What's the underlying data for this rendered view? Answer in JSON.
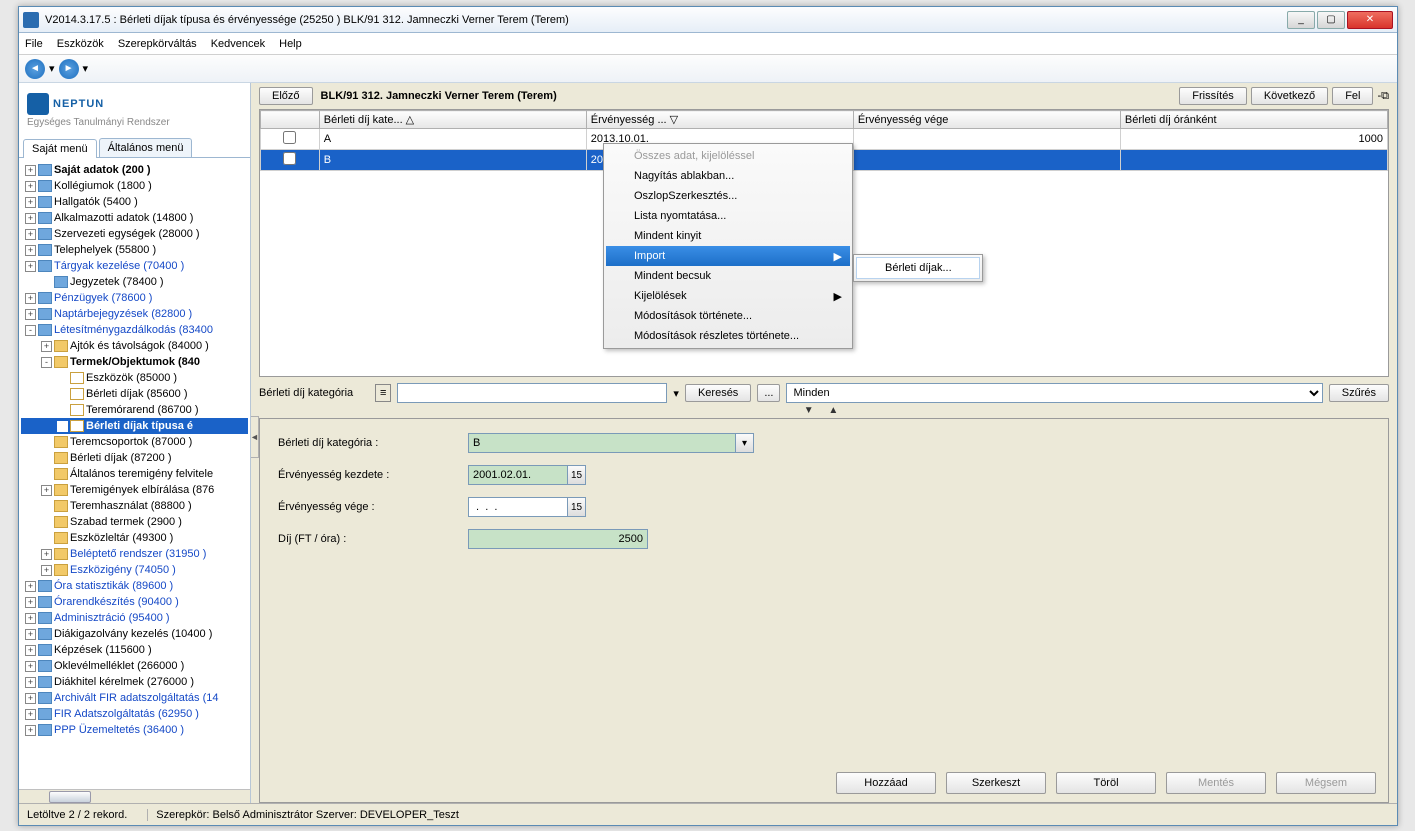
{
  "window": {
    "title": "V2014.3.17.5 : Bérleti díjak típusa és érvényessége (25250  ) BLK/91 312. Jamneczki Verner Terem (Terem)"
  },
  "menubar": [
    "File",
    "Eszközök",
    "Szerepkörváltás",
    "Kedvencek",
    "Help"
  ],
  "logo": {
    "text": "NEPTUN",
    "sub": "Egységes Tanulmányi Rendszer"
  },
  "side_tabs": {
    "a": "Saját menü",
    "b": "Általános menü"
  },
  "tree": [
    {
      "ind": 0,
      "t": "+",
      "ic": "blue",
      "lbl": "Saját adatok (200  )",
      "cls": "bold"
    },
    {
      "ind": 0,
      "t": "+",
      "ic": "blue",
      "lbl": "Kollégiumok (1800  )"
    },
    {
      "ind": 0,
      "t": "+",
      "ic": "blue",
      "lbl": "Hallgatók (5400  )"
    },
    {
      "ind": 0,
      "t": "+",
      "ic": "blue",
      "lbl": "Alkalmazotti adatok (14800  )"
    },
    {
      "ind": 0,
      "t": "+",
      "ic": "blue",
      "lbl": "Szervezeti egységek (28000  )"
    },
    {
      "ind": 0,
      "t": "+",
      "ic": "blue",
      "lbl": "Telephelyek (55800  )"
    },
    {
      "ind": 0,
      "t": "+",
      "ic": "blue",
      "lbl": "Tárgyak kezelése (70400  )",
      "cls": "link"
    },
    {
      "ind": 1,
      "t": " ",
      "ic": "blue",
      "lbl": "Jegyzetek (78400  )"
    },
    {
      "ind": 0,
      "t": "+",
      "ic": "blue",
      "lbl": "Pénzügyek (78600  )",
      "cls": "link"
    },
    {
      "ind": 0,
      "t": "+",
      "ic": "blue",
      "lbl": "Naptárbejegyzések (82800  )",
      "cls": "link"
    },
    {
      "ind": 0,
      "t": "-",
      "ic": "blue",
      "lbl": "Létesítménygazdálkodás (83400",
      "cls": "link"
    },
    {
      "ind": 1,
      "t": "+",
      "ic": "y",
      "lbl": "Ajtók és távolságok (84000  )"
    },
    {
      "ind": 1,
      "t": "-",
      "ic": "y",
      "lbl": "Termek/Objektumok (840",
      "cls": "bold"
    },
    {
      "ind": 2,
      "t": " ",
      "ic": "page",
      "lbl": "Eszközök (85000  )"
    },
    {
      "ind": 2,
      "t": " ",
      "ic": "page",
      "lbl": "Bérleti díjak (85600  )"
    },
    {
      "ind": 2,
      "t": " ",
      "ic": "page",
      "lbl": "Teremórarend (86700  )"
    },
    {
      "ind": 2,
      "t": " ",
      "ic": "page",
      "lbl": "Bérleti díjak típusa é",
      "sel": true
    },
    {
      "ind": 1,
      "t": " ",
      "ic": "y",
      "lbl": "Teremcsoportok (87000  )"
    },
    {
      "ind": 1,
      "t": " ",
      "ic": "y",
      "lbl": "Bérleti díjak (87200  )"
    },
    {
      "ind": 1,
      "t": " ",
      "ic": "y",
      "lbl": "Általános teremigény felvitele"
    },
    {
      "ind": 1,
      "t": "+",
      "ic": "y",
      "lbl": "Teremigények elbírálása (876"
    },
    {
      "ind": 1,
      "t": " ",
      "ic": "y",
      "lbl": "Teremhasználat (88800  )"
    },
    {
      "ind": 1,
      "t": " ",
      "ic": "y",
      "lbl": "Szabad termek (2900  )"
    },
    {
      "ind": 1,
      "t": " ",
      "ic": "y",
      "lbl": "Eszközleltár (49300  )"
    },
    {
      "ind": 1,
      "t": "+",
      "ic": "y",
      "lbl": "Beléptető rendszer (31950  )",
      "cls": "link"
    },
    {
      "ind": 1,
      "t": "+",
      "ic": "y",
      "lbl": "Eszközigény (74050  )",
      "cls": "link"
    },
    {
      "ind": 0,
      "t": "+",
      "ic": "blue",
      "lbl": "Óra statisztikák (89600  )",
      "cls": "link"
    },
    {
      "ind": 0,
      "t": "+",
      "ic": "blue",
      "lbl": "Órarendkészítés (90400  )",
      "cls": "link"
    },
    {
      "ind": 0,
      "t": "+",
      "ic": "blue",
      "lbl": "Adminisztráció (95400  )",
      "cls": "link"
    },
    {
      "ind": 0,
      "t": "+",
      "ic": "blue",
      "lbl": "Diákigazolvány kezelés (10400  )"
    },
    {
      "ind": 0,
      "t": "+",
      "ic": "blue",
      "lbl": "Képzések (115600  )"
    },
    {
      "ind": 0,
      "t": "+",
      "ic": "blue",
      "lbl": "Oklevélmelléklet (266000  )"
    },
    {
      "ind": 0,
      "t": "+",
      "ic": "blue",
      "lbl": "Diákhitel kérelmek (276000  )"
    },
    {
      "ind": 0,
      "t": "+",
      "ic": "blue",
      "lbl": "Archivált FIR adatszolgáltatás (14",
      "cls": "link"
    },
    {
      "ind": 0,
      "t": "+",
      "ic": "blue",
      "lbl": "FIR Adatszolgáltatás (62950  )",
      "cls": "link"
    },
    {
      "ind": 0,
      "t": "+",
      "ic": "blue",
      "lbl": "PPP Üzemeltetés (36400  )",
      "cls": "link"
    }
  ],
  "main": {
    "prev_btn": "Előző",
    "crumb": "BLK/91 312. Jamneczki Verner Terem (Terem)",
    "refresh": "Frissítés",
    "next": "Következő",
    "up": "Fel"
  },
  "grid": {
    "headers": [
      "",
      "Bérleti díj kate...",
      "Érvényesség ...",
      "Érvényesség vége",
      "Bérleti díj óránként"
    ],
    "rows": [
      {
        "chk": "",
        "cat": "A",
        "from": "2013.10.01.",
        "to": "",
        "rate": "1000"
      },
      {
        "chk": "",
        "cat": "B",
        "from": "2001.02.01.",
        "to": "",
        "rate": "",
        "sel": true
      }
    ]
  },
  "ctx": {
    "items": [
      {
        "l": "Összes adat, kijelöléssel",
        "dis": true
      },
      {
        "l": "Nagyítás ablakban..."
      },
      {
        "l": "OszlopSzerkesztés..."
      },
      {
        "l": "Lista nyomtatása..."
      },
      {
        "l": "Mindent kinyit"
      },
      {
        "l": "Import",
        "sel": true,
        "sub": true
      },
      {
        "l": "Mindent becsuk"
      },
      {
        "l": "Kijelölések",
        "sub": true
      },
      {
        "l": "Módosítások története..."
      },
      {
        "l": "Módosítások részletes története..."
      }
    ],
    "submenu": "Bérleti díjak..."
  },
  "search": {
    "label": "Bérleti díj kategória",
    "btn": "Keresés",
    "all": "Minden",
    "filter": "Szűrés"
  },
  "form": {
    "f1l": "Bérleti díj kategória :",
    "f1v": "B",
    "f2l": "Érvényesség kezdete :",
    "f2v": "2001.02.01.",
    "f3l": "Érvényesség vége :",
    "f3v": " .  .  .",
    "f4l": "Díj  (FT / óra) :",
    "f4v": "2500"
  },
  "actions": {
    "add": "Hozzáad",
    "edit": "Szerkeszt",
    "del": "Töröl",
    "save": "Mentés",
    "cancel": "Mégsem"
  },
  "status": {
    "left": "Letöltve 2 / 2 rekord.",
    "mid": "Szerepkör: Belső Adminisztrátor   Szerver: DEVELOPER_Teszt"
  }
}
